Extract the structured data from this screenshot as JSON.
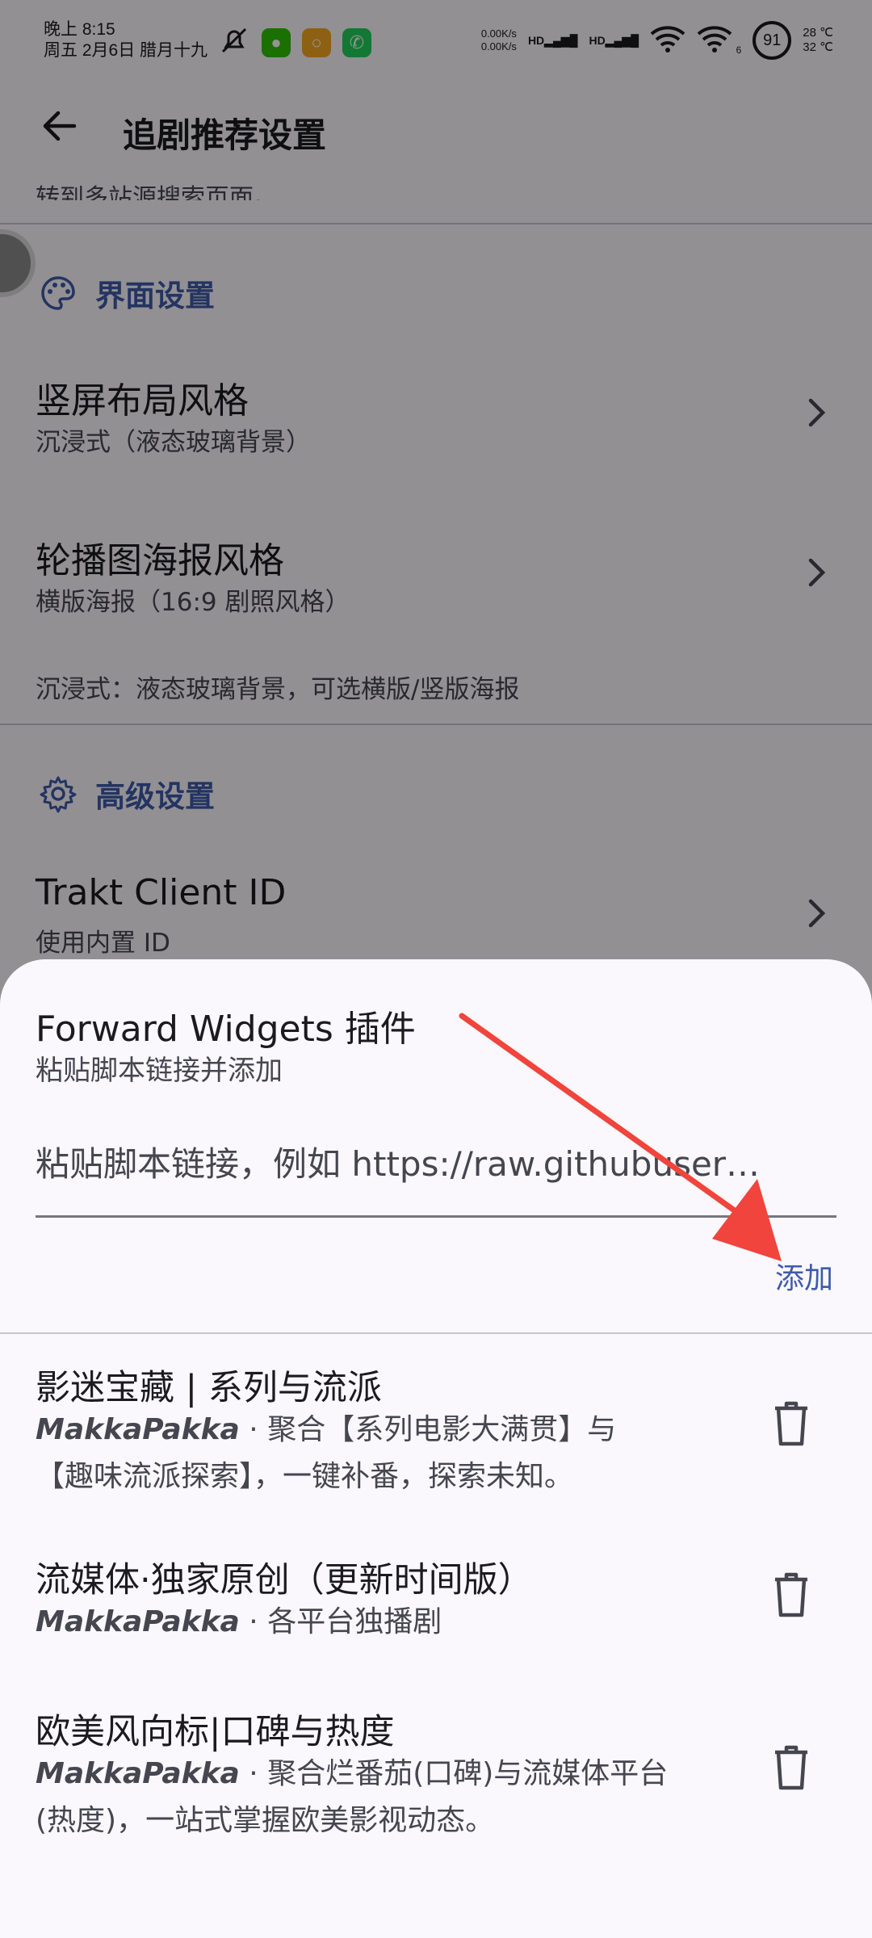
{
  "status_bar": {
    "time": "晚上 8:15",
    "date": "周五 2月6日 腊月十九",
    "net_up": "0.00K/s",
    "net_down": "0.00K/s",
    "signal_1": "HD",
    "signal_2": "HD",
    "wifi_badge": "6",
    "battery": "91",
    "temp_high": "28 ℃",
    "temp_low": "32 ℃"
  },
  "appbar": {
    "title": "追剧推荐设置"
  },
  "clipped_text": "转到多站源搜索页面。",
  "ui_section": {
    "title": "界面设置",
    "rows": [
      {
        "title": "竖屏布局风格",
        "subtitle": "沉浸式（液态玻璃背景）"
      },
      {
        "title": "轮播图海报风格",
        "subtitle": "横版海报（16:9 剧照风格）"
      }
    ],
    "helper": "沉浸式：液态玻璃背景，可选横版/竖版海报"
  },
  "advanced_section": {
    "title": "高级设置",
    "rows": [
      {
        "title": "Trakt Client ID",
        "subtitle": "使用内置 ID"
      }
    ]
  },
  "sheet": {
    "title": "Forward Widgets 插件",
    "subtitle": "粘贴脚本链接并添加",
    "input_placeholder": "粘贴脚本链接，例如 https://raw.githubuser…",
    "add_label": "添加",
    "plugins": [
      {
        "name": "影迷宝藏 | 系列与流派",
        "author": "MakkaPakka",
        "separator": " · ",
        "desc": "聚合【系列电影大满贯】与【趣味流派探索】，一键补番，探索未知。"
      },
      {
        "name": "流媒体·独家原创（更新时间版）",
        "author": "MakkaPakka",
        "separator": " · ",
        "desc": "各平台独播剧"
      },
      {
        "name": "欧美风向标|口碑与热度",
        "author": "MakkaPakka",
        "separator": " · ",
        "desc": "聚合烂番茄(口碑)与流媒体平台(热度)，一站式掌握欧美影视动态。"
      }
    ]
  },
  "colors": {
    "accent": "#3f5aa9",
    "annotation": "#f0443c",
    "scrim": "rgba(0,0,0,0.42)"
  }
}
